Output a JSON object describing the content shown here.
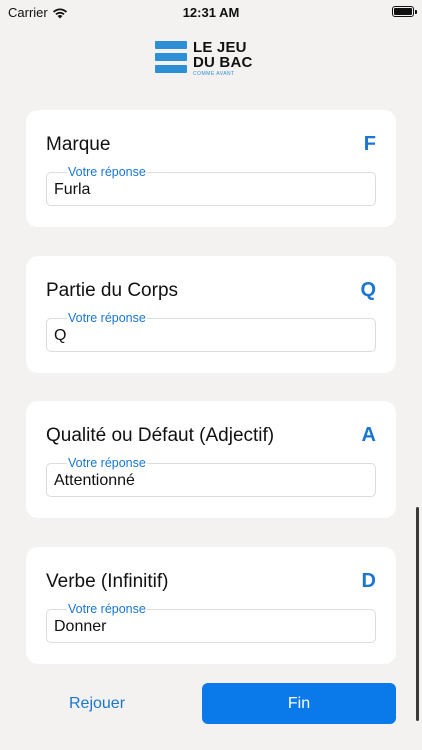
{
  "status_bar": {
    "carrier": "Carrier",
    "time": "12:31 AM"
  },
  "logo": {
    "line1": "LE JEU",
    "line2": "DU BAC",
    "tagline": "COMME AVANT",
    "color": "#2d8fd5"
  },
  "categories": [
    {
      "title": "Marque",
      "letter": "F",
      "label": "Votre réponse",
      "value": "Furla"
    },
    {
      "title": "Partie du Corps",
      "letter": "Q",
      "label": "Votre réponse",
      "value": "Q"
    },
    {
      "title": "Qualité ou Défaut (Adjectif)",
      "letter": "A",
      "label": "Votre réponse",
      "value": "Attentionné"
    },
    {
      "title": "Verbe (Infinitif)",
      "letter": "D",
      "label": "Votre réponse",
      "value": "Donner"
    }
  ],
  "actions": {
    "replay_label": "Rejouer",
    "end_label": "Fin"
  },
  "colors": {
    "accent": "#1976d2",
    "primary_button": "#0a7aea",
    "background": "#f3f2f0"
  }
}
